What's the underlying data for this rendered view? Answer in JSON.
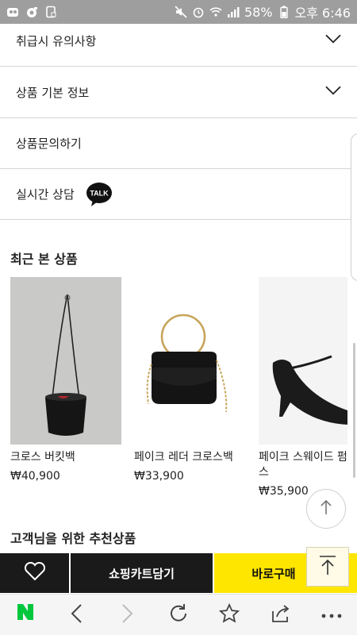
{
  "status_bar": {
    "battery_percent": "58%",
    "time": "오후 6:46"
  },
  "accordion": [
    {
      "label": "취급시 유의사항"
    },
    {
      "label": "상품 기본 정보"
    },
    {
      "label": "상품문의하기"
    },
    {
      "label": "실시간 상담",
      "badge": "TALK"
    }
  ],
  "recent": {
    "title": "최근 본 상품",
    "items": [
      {
        "name": "크로스 버킷백",
        "price": "₩40,900"
      },
      {
        "name": "페이크 레더 크로스백",
        "price": "₩33,900"
      },
      {
        "name": "페이크 스웨이드 펌스",
        "price": "₩35,900"
      }
    ]
  },
  "recommend": {
    "title": "고객님을 위한 추천상품"
  },
  "actions": {
    "cart_label": "쇼핑카트담기",
    "buy_label": "바로구매"
  },
  "colors": {
    "accent_buy": "#ffe600",
    "bar_dark": "#1a1a1a",
    "naver_green": "#00c73c"
  }
}
